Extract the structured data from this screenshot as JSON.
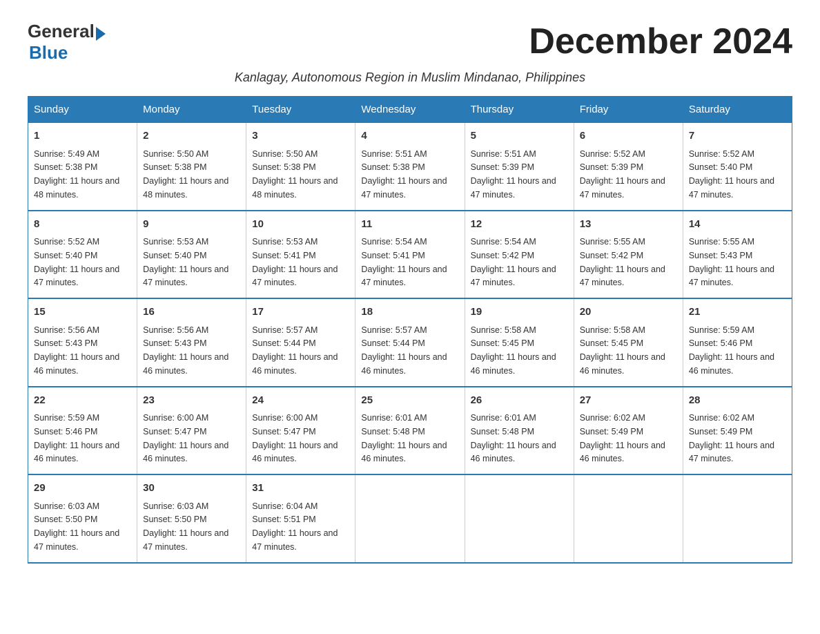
{
  "logo": {
    "general": "General",
    "blue": "Blue"
  },
  "title": "December 2024",
  "subtitle": "Kanlagay, Autonomous Region in Muslim Mindanao, Philippines",
  "headers": [
    "Sunday",
    "Monday",
    "Tuesday",
    "Wednesday",
    "Thursday",
    "Friday",
    "Saturday"
  ],
  "weeks": [
    [
      {
        "day": "1",
        "sunrise": "5:49 AM",
        "sunset": "5:38 PM",
        "daylight": "11 hours and 48 minutes."
      },
      {
        "day": "2",
        "sunrise": "5:50 AM",
        "sunset": "5:38 PM",
        "daylight": "11 hours and 48 minutes."
      },
      {
        "day": "3",
        "sunrise": "5:50 AM",
        "sunset": "5:38 PM",
        "daylight": "11 hours and 48 minutes."
      },
      {
        "day": "4",
        "sunrise": "5:51 AM",
        "sunset": "5:38 PM",
        "daylight": "11 hours and 47 minutes."
      },
      {
        "day": "5",
        "sunrise": "5:51 AM",
        "sunset": "5:39 PM",
        "daylight": "11 hours and 47 minutes."
      },
      {
        "day": "6",
        "sunrise": "5:52 AM",
        "sunset": "5:39 PM",
        "daylight": "11 hours and 47 minutes."
      },
      {
        "day": "7",
        "sunrise": "5:52 AM",
        "sunset": "5:40 PM",
        "daylight": "11 hours and 47 minutes."
      }
    ],
    [
      {
        "day": "8",
        "sunrise": "5:52 AM",
        "sunset": "5:40 PM",
        "daylight": "11 hours and 47 minutes."
      },
      {
        "day": "9",
        "sunrise": "5:53 AM",
        "sunset": "5:40 PM",
        "daylight": "11 hours and 47 minutes."
      },
      {
        "day": "10",
        "sunrise": "5:53 AM",
        "sunset": "5:41 PM",
        "daylight": "11 hours and 47 minutes."
      },
      {
        "day": "11",
        "sunrise": "5:54 AM",
        "sunset": "5:41 PM",
        "daylight": "11 hours and 47 minutes."
      },
      {
        "day": "12",
        "sunrise": "5:54 AM",
        "sunset": "5:42 PM",
        "daylight": "11 hours and 47 minutes."
      },
      {
        "day": "13",
        "sunrise": "5:55 AM",
        "sunset": "5:42 PM",
        "daylight": "11 hours and 47 minutes."
      },
      {
        "day": "14",
        "sunrise": "5:55 AM",
        "sunset": "5:43 PM",
        "daylight": "11 hours and 47 minutes."
      }
    ],
    [
      {
        "day": "15",
        "sunrise": "5:56 AM",
        "sunset": "5:43 PM",
        "daylight": "11 hours and 46 minutes."
      },
      {
        "day": "16",
        "sunrise": "5:56 AM",
        "sunset": "5:43 PM",
        "daylight": "11 hours and 46 minutes."
      },
      {
        "day": "17",
        "sunrise": "5:57 AM",
        "sunset": "5:44 PM",
        "daylight": "11 hours and 46 minutes."
      },
      {
        "day": "18",
        "sunrise": "5:57 AM",
        "sunset": "5:44 PM",
        "daylight": "11 hours and 46 minutes."
      },
      {
        "day": "19",
        "sunrise": "5:58 AM",
        "sunset": "5:45 PM",
        "daylight": "11 hours and 46 minutes."
      },
      {
        "day": "20",
        "sunrise": "5:58 AM",
        "sunset": "5:45 PM",
        "daylight": "11 hours and 46 minutes."
      },
      {
        "day": "21",
        "sunrise": "5:59 AM",
        "sunset": "5:46 PM",
        "daylight": "11 hours and 46 minutes."
      }
    ],
    [
      {
        "day": "22",
        "sunrise": "5:59 AM",
        "sunset": "5:46 PM",
        "daylight": "11 hours and 46 minutes."
      },
      {
        "day": "23",
        "sunrise": "6:00 AM",
        "sunset": "5:47 PM",
        "daylight": "11 hours and 46 minutes."
      },
      {
        "day": "24",
        "sunrise": "6:00 AM",
        "sunset": "5:47 PM",
        "daylight": "11 hours and 46 minutes."
      },
      {
        "day": "25",
        "sunrise": "6:01 AM",
        "sunset": "5:48 PM",
        "daylight": "11 hours and 46 minutes."
      },
      {
        "day": "26",
        "sunrise": "6:01 AM",
        "sunset": "5:48 PM",
        "daylight": "11 hours and 46 minutes."
      },
      {
        "day": "27",
        "sunrise": "6:02 AM",
        "sunset": "5:49 PM",
        "daylight": "11 hours and 46 minutes."
      },
      {
        "day": "28",
        "sunrise": "6:02 AM",
        "sunset": "5:49 PM",
        "daylight": "11 hours and 47 minutes."
      }
    ],
    [
      {
        "day": "29",
        "sunrise": "6:03 AM",
        "sunset": "5:50 PM",
        "daylight": "11 hours and 47 minutes."
      },
      {
        "day": "30",
        "sunrise": "6:03 AM",
        "sunset": "5:50 PM",
        "daylight": "11 hours and 47 minutes."
      },
      {
        "day": "31",
        "sunrise": "6:04 AM",
        "sunset": "5:51 PM",
        "daylight": "11 hours and 47 minutes."
      },
      null,
      null,
      null,
      null
    ]
  ]
}
